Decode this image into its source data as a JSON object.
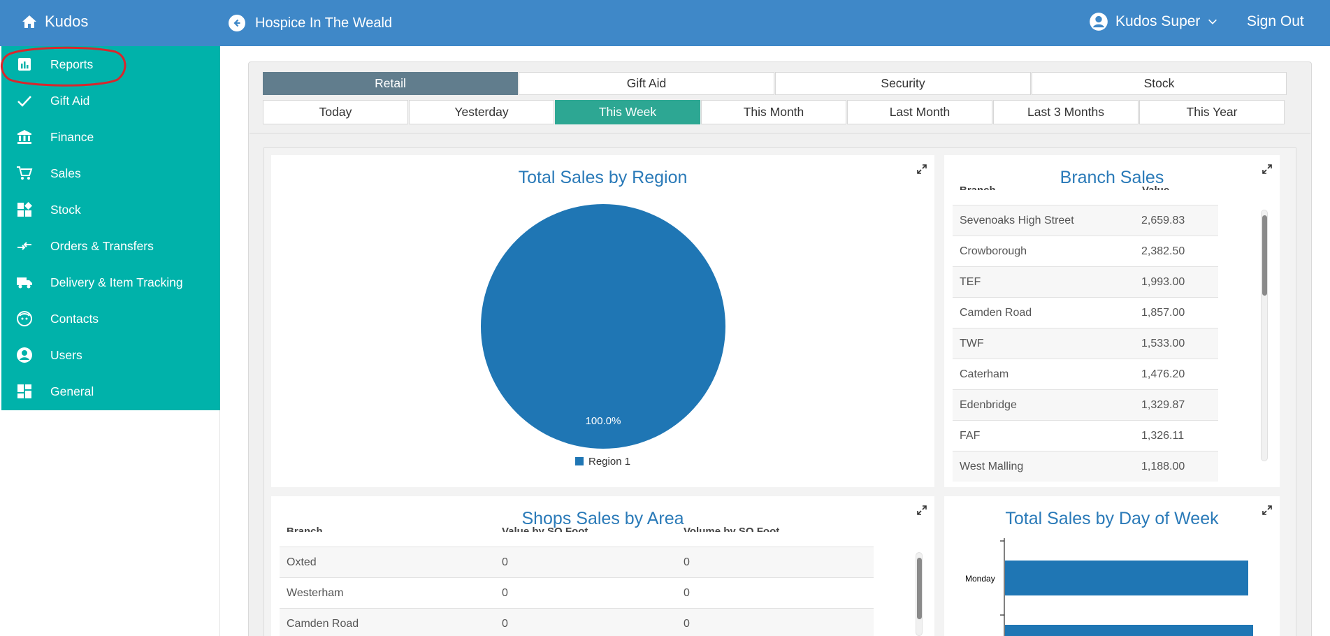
{
  "app": {
    "brand": "Kudos",
    "org_name": "Hospice In The Weald",
    "user_name": "Kudos Super",
    "sign_out": "Sign Out"
  },
  "sidebar": {
    "items": [
      {
        "label": "Reports",
        "icon": "reports-icon"
      },
      {
        "label": "Gift Aid",
        "icon": "check-icon"
      },
      {
        "label": "Finance",
        "icon": "bank-icon"
      },
      {
        "label": "Sales",
        "icon": "cart-icon"
      },
      {
        "label": "Stock",
        "icon": "stock-icon"
      },
      {
        "label": "Orders & Transfers",
        "icon": "transfer-icon"
      },
      {
        "label": "Delivery & Item Tracking",
        "icon": "truck-icon"
      },
      {
        "label": "Contacts",
        "icon": "contacts-icon"
      },
      {
        "label": "Users",
        "icon": "user-icon"
      },
      {
        "label": "General",
        "icon": "dashboard-icon"
      }
    ]
  },
  "report_tabs": [
    "Retail",
    "Gift Aid",
    "Security",
    "Stock"
  ],
  "active_report_tab": "Retail",
  "period_tabs": [
    "Today",
    "Yesterday",
    "This Week",
    "This Month",
    "Last Month",
    "Last 3 Months",
    "This Year"
  ],
  "active_period_tab": "This Week",
  "colors": {
    "topbar": "#3f88c8",
    "sidebar": "#00b2aa",
    "active_report_tab": "#617d8d",
    "active_period_tab": "#2da793",
    "chart_blue": "#1f76b4",
    "title_blue": "#2a7ab8",
    "annotation_red": "#d9262c"
  },
  "region_card": {
    "title": "Total Sales by Region"
  },
  "branch_card": {
    "title": "Branch Sales",
    "header_branch": "Branch",
    "header_value": "Value",
    "rows": [
      {
        "branch": "Sevenoaks High Street",
        "value": "2,659.83"
      },
      {
        "branch": "Crowborough",
        "value": "2,382.50"
      },
      {
        "branch": "TEF",
        "value": "1,993.00"
      },
      {
        "branch": "Camden Road",
        "value": "1,857.00"
      },
      {
        "branch": "TWF",
        "value": "1,533.00"
      },
      {
        "branch": "Caterham",
        "value": "1,476.20"
      },
      {
        "branch": "Edenbridge",
        "value": "1,329.87"
      },
      {
        "branch": "FAF",
        "value": "1,326.11"
      },
      {
        "branch": "West Malling",
        "value": "1,188.00"
      }
    ]
  },
  "area_card": {
    "title": "Shops Sales by Area",
    "header_branch": "Branch",
    "header_value": "Value by SQ Foot",
    "header_volume": "Volume by SQ Foot",
    "rows": [
      {
        "branch": "Oxted",
        "value": "0",
        "volume": "0"
      },
      {
        "branch": "Westerham",
        "value": "0",
        "volume": "0"
      },
      {
        "branch": "Camden Road",
        "value": "0",
        "volume": "0"
      }
    ]
  },
  "dow_card": {
    "title": "Total Sales by Day of Week"
  },
  "chart_data": [
    {
      "type": "pie",
      "title": "Total Sales by Region",
      "slices": [
        {
          "label": "Region 1",
          "value": 100.0,
          "display": "100.0%"
        }
      ],
      "legend": "bottom"
    },
    {
      "type": "bar",
      "orientation": "horizontal",
      "title": "Total Sales by Day of Week",
      "categories": [
        "Monday"
      ],
      "values": [
        0.94
      ],
      "note": "bars shown as relative fill of visible axis; second bar partially visible"
    }
  ]
}
